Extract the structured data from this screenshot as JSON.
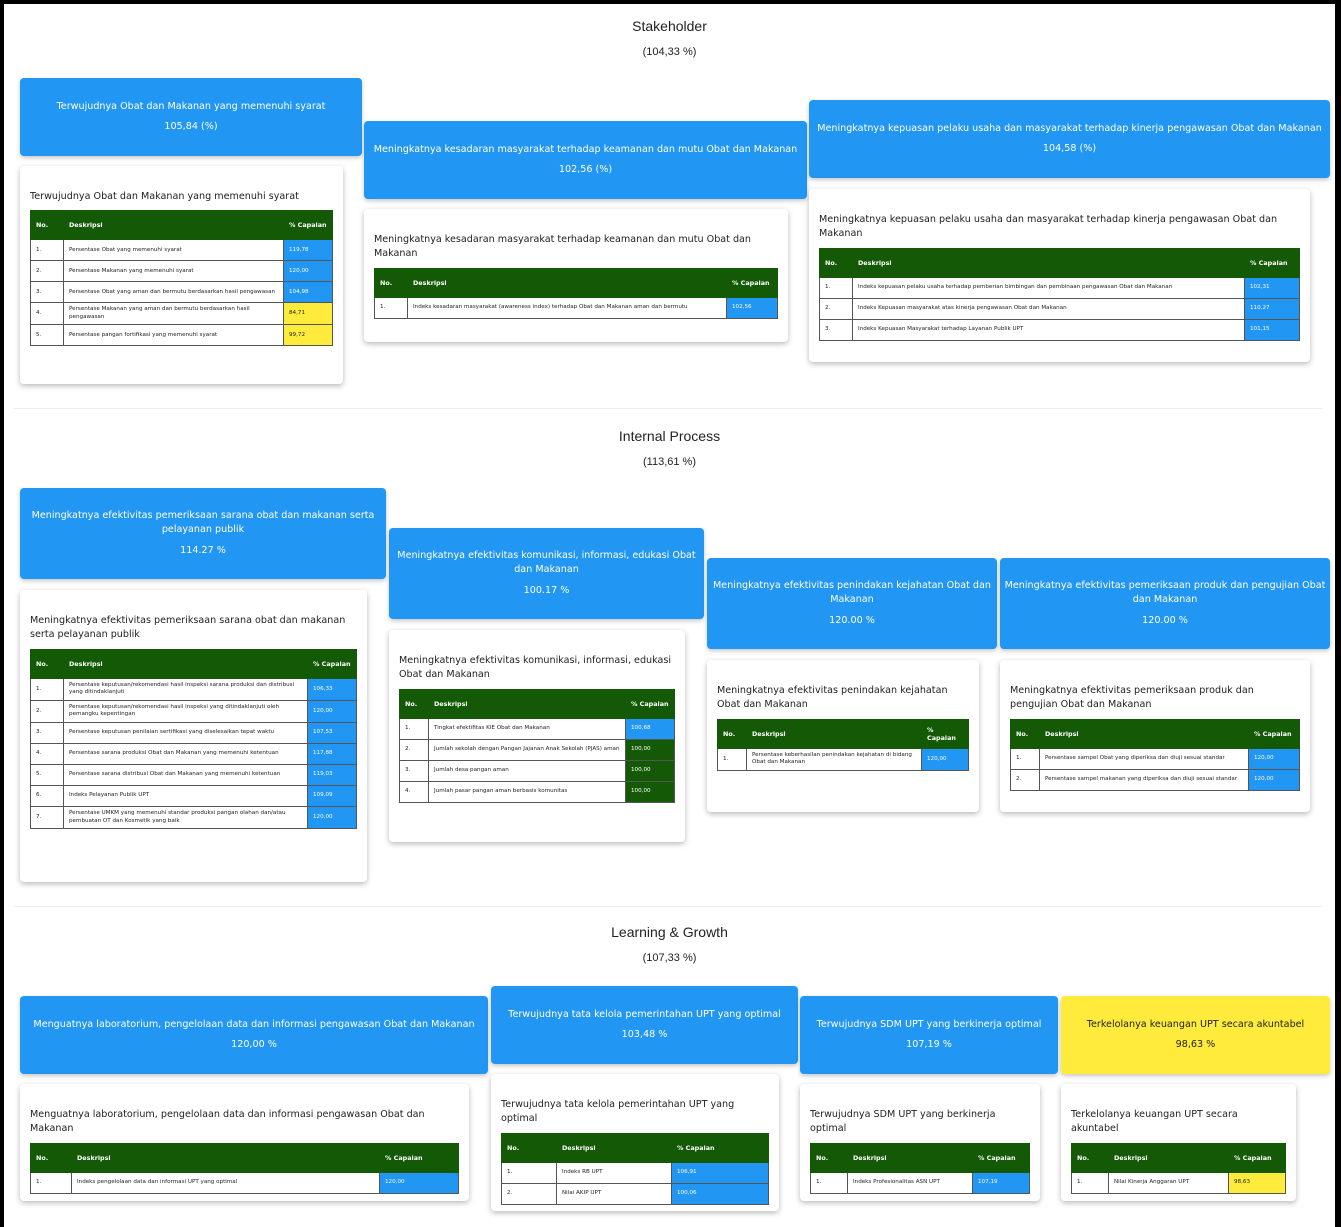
{
  "sections": [
    {
      "title": "Stakeholder",
      "pct": "(104,33 %)",
      "headers": [
        {
          "title": "Terwujudnya Obat dan Makanan yang memenuhi syarat",
          "pct": "105,84 (%)",
          "color": "blue"
        },
        {
          "title": "Meningkatnya kesadaran masyarakat terhadap keamanan dan mutu Obat dan Makanan",
          "pct": "102,56 (%)",
          "color": "blue"
        },
        {
          "title": "Meningkatnya kepuasan pelaku usaha dan masyarakat terhadap kinerja pengawasan Obat dan Makanan",
          "pct": "104,58 (%)",
          "color": "blue"
        }
      ],
      "cards": [
        {
          "title": "Terwujudnya Obat dan Makanan yang memenuhi syarat",
          "col_no": "No.",
          "col_desc": "Deskripsi",
          "col_pct": "% Capaian",
          "rows": [
            {
              "no": "1.",
              "desc": "Persentase Obat yang memenuhi syarat",
              "val": "119,78",
              "color": "blue"
            },
            {
              "no": "2.",
              "desc": "Persentase Makanan yang memenuhi syarat",
              "val": "120,00",
              "color": "blue"
            },
            {
              "no": "3.",
              "desc": "Persentase Obat yang aman dan bermutu berdasarkan hasil pengawasan",
              "val": "104,98",
              "color": "blue"
            },
            {
              "no": "4.",
              "desc": "Persentase Makanan yang aman dan bermutu berdasarkan hasil pengawasan",
              "val": "84,71",
              "color": "yellow"
            },
            {
              "no": "5.",
              "desc": "Persentase pangan fortifikasi yang memenuhi syarat",
              "val": "99,72",
              "color": "yellow"
            }
          ]
        },
        {
          "title": "Meningkatnya kesadaran masyarakat terhadap keamanan dan mutu Obat dan Makanan",
          "col_no": "No.",
          "col_desc": "Deskripsi",
          "col_pct": "% Capaian",
          "rows": [
            {
              "no": "1.",
              "desc": "Indeks kesadaran masyarakat (awareness index) terhadap Obat dan Makanan aman dan bermutu",
              "val": "102,56",
              "color": "blue"
            }
          ]
        },
        {
          "title": "Meningkatnya kepuasan pelaku usaha dan masyarakat terhadap kinerja pengawasan Obat dan Makanan",
          "col_no": "No.",
          "col_desc": "Deskripsi",
          "col_pct": "% Capaian",
          "rows": [
            {
              "no": "1.",
              "desc": "Indeks kepuasan pelaku usaha terhadap pemberian bimbingan dan pembinaan pengawasan Obat dan Makanan",
              "val": "102,31",
              "color": "blue"
            },
            {
              "no": "2.",
              "desc": "Indeks Kepuasan masyarakat atas kinerja pengawasan Obat dan Makanan",
              "val": "110,27",
              "color": "blue"
            },
            {
              "no": "3.",
              "desc": "Indeks Kepuasan Masyarakat terhadap Layanan Publik UPT",
              "val": "101,15",
              "color": "blue"
            }
          ]
        }
      ]
    },
    {
      "title": "Internal Process",
      "pct": "(113,61 %)",
      "headers": [
        {
          "title": "Meningkatnya efektivitas pemeriksaan sarana obat dan makanan serta pelayanan publik",
          "pct": "114.27 %",
          "color": "blue"
        },
        {
          "title": "Meningkatnya efektivitas komunikasi, informasi, edukasi Obat dan Makanan",
          "pct": "100.17 %",
          "color": "blue"
        },
        {
          "title": "Meningkatnya efektivitas penindakan kejahatan Obat dan Makanan",
          "pct": "120.00 %",
          "color": "blue"
        },
        {
          "title": "Meningkatnya efektivitas pemeriksaan produk dan pengujian Obat dan Makanan",
          "pct": "120.00 %",
          "color": "blue"
        }
      ],
      "cards": [
        {
          "title": "Meningkatnya efektivitas pemeriksaan sarana obat dan makanan serta pelayanan publik",
          "col_no": "No.",
          "col_desc": "Deskripsi",
          "col_pct": "% Capaian",
          "rows": [
            {
              "no": "1.",
              "desc": "Persentase keputusan/rekomendasi hasil inspeksi sarana produksi dan distribusi yang ditindaklanjuti",
              "val": "106,33",
              "color": "blue"
            },
            {
              "no": "2.",
              "desc": "Persentase keputusan/rekomendasi hasil inspeksi yang ditindaklanjuti oleh pemangku kepentingan",
              "val": "120,00",
              "color": "blue"
            },
            {
              "no": "3.",
              "desc": "Persentase keputusan penilaian sertifikasi yang diselesaikan tepat waktu",
              "val": "107,53",
              "color": "blue"
            },
            {
              "no": "4.",
              "desc": "Persentase sarana produksi Obat dan Makanan yang memenuhi ketentuan",
              "val": "117,88",
              "color": "blue"
            },
            {
              "no": "5.",
              "desc": "Persentase sarana distribusi Obat dan Makanan yang memenuhi ketentuan",
              "val": "119,03",
              "color": "blue"
            },
            {
              "no": "6.",
              "desc": "Indeks Pelayanan Publik UPT",
              "val": "109,09",
              "color": "blue"
            },
            {
              "no": "7.",
              "desc": "Persentase UMKM yang memenuhi standar produksi pangan olahan dan/atau pembuatan OT dan Kosmetik yang baik",
              "val": "120,00",
              "color": "blue"
            }
          ]
        },
        {
          "title": "Meningkatnya efektivitas komunikasi, informasi, edukasi Obat dan Makanan",
          "col_no": "No.",
          "col_desc": "Deskripsi",
          "col_pct": "% Capaian",
          "rows": [
            {
              "no": "1.",
              "desc": "Tingkat efektifitas KIE Obat dan Makanan",
              "val": "100,68",
              "color": "blue"
            },
            {
              "no": "2.",
              "desc": "Jumlah sekolah dengan Pangan Jajanan Anak Sekolah (PJAS) aman",
              "val": "100,00",
              "color": "green"
            },
            {
              "no": "3.",
              "desc": "Jumlah desa pangan aman",
              "val": "100,00",
              "color": "green"
            },
            {
              "no": "4.",
              "desc": "Jumlah pasar pangan aman berbasis komunitas",
              "val": "100,00",
              "color": "green"
            }
          ]
        },
        {
          "title": "Meningkatnya efektivitas penindakan kejahatan Obat dan Makanan",
          "col_no": "No.",
          "col_desc": "Deskripsi",
          "col_pct": "% Capaian",
          "rows": [
            {
              "no": "1.",
              "desc": "Persentase keberhasilan penindakan kejahatan di bidang Obat dan Makanan",
              "val": "120,00",
              "color": "blue"
            }
          ]
        },
        {
          "title": "Meningkatnya efektivitas pemeriksaan produk dan pengujian Obat dan Makanan",
          "col_no": "No.",
          "col_desc": "Deskripsi",
          "col_pct": "% Capaian",
          "rows": [
            {
              "no": "1.",
              "desc": "Persentase sampel Obat yang diperiksa dan diuji sesuai standar",
              "val": "120,00",
              "color": "blue"
            },
            {
              "no": "2.",
              "desc": "Persentase sampel makanan yang diperiksa dan diuji sesuai standar",
              "val": "120,00",
              "color": "blue"
            }
          ]
        }
      ]
    },
    {
      "title": "Learning & Growth",
      "pct": "(107,33 %)",
      "headers": [
        {
          "title": "Menguatnya laboratorium, pengelolaan data dan informasi pengawasan Obat dan Makanan",
          "pct": "120,00 %",
          "color": "blue"
        },
        {
          "title": "Terwujudnya tata kelola pemerintahan UPT yang optimal",
          "pct": "103,48 %",
          "color": "blue"
        },
        {
          "title": "Terwujudnya SDM UPT yang berkinerja optimal",
          "pct": "107,19 %",
          "color": "blue"
        },
        {
          "title": "Terkelolanya keuangan UPT secara akuntabel",
          "pct": "98,63 %",
          "color": "yellow"
        }
      ],
      "cards": [
        {
          "title": "Menguatnya laboratorium, pengelolaan data dan informasi pengawasan Obat dan Makanan",
          "col_no": "No.",
          "col_desc": "Deskripsi",
          "col_pct": "% Capaian",
          "rows": [
            {
              "no": "1.",
              "desc": "Indeks pengelolaan data dan informasi UPT yang optimal",
              "val": "120,00",
              "color": "blue"
            }
          ]
        },
        {
          "title": "Terwujudnya tata kelola pemerintahan UPT yang optimal",
          "col_no": "No.",
          "col_desc": "Deskripsi",
          "col_pct": "% Capaian",
          "rows": [
            {
              "no": "1.",
              "desc": "Indeks RB UPT",
              "val": "106,91",
              "color": "blue"
            },
            {
              "no": "2.",
              "desc": "Nilai AKIP UPT",
              "val": "100,06",
              "color": "blue"
            }
          ]
        },
        {
          "title": "Terwujudnya SDM UPT yang berkinerja optimal",
          "col_no": "No.",
          "col_desc": "Deskripsi",
          "col_pct": "% Capaian",
          "rows": [
            {
              "no": "1.",
              "desc": "Indeks Profesionalitas ASN UPT",
              "val": "107,19",
              "color": "blue"
            }
          ]
        },
        {
          "title": "Terkelolanya keuangan UPT secara akuntabel",
          "col_no": "No.",
          "col_desc": "Deskripsi",
          "col_pct": "% Capaian",
          "rows": [
            {
              "no": "1.",
              "desc": "Nilai Kinerja Anggaran UPT",
              "val": "98,63",
              "color": "yellow"
            }
          ]
        }
      ]
    }
  ]
}
